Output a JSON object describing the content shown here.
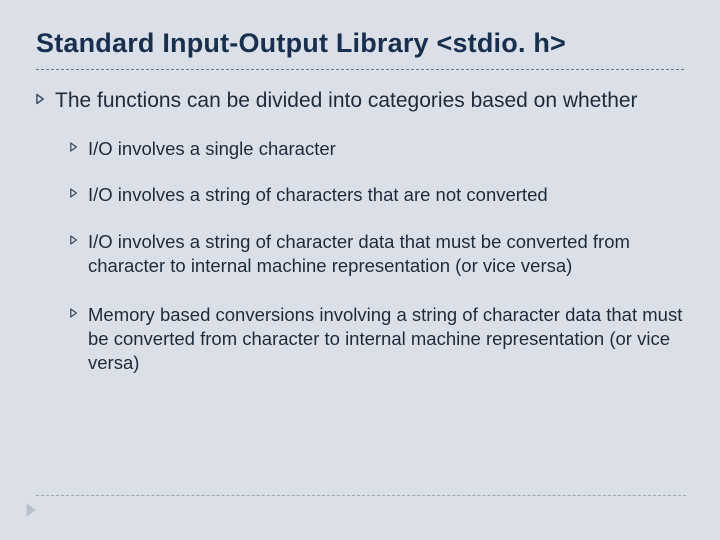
{
  "slide": {
    "title": "Standard Input-Output Library <stdio. h>",
    "intro": "The functions can be divided into categories based on whether",
    "bullets": [
      "I/O involves a single character",
      "I/O involves a string of characters that are not converted",
      "I/O involves a string of character data that must be converted from character to internal machine representation (or vice versa)",
      "Memory based conversions involving a string of character data that must be converted from character to internal machine representation (or vice versa)"
    ]
  },
  "colors": {
    "background": "#dbe0e8",
    "heading": "#18304e",
    "body": "#1e2a3a",
    "arrow": "#3a4d63",
    "footerArrow": "#9aa8b6"
  }
}
